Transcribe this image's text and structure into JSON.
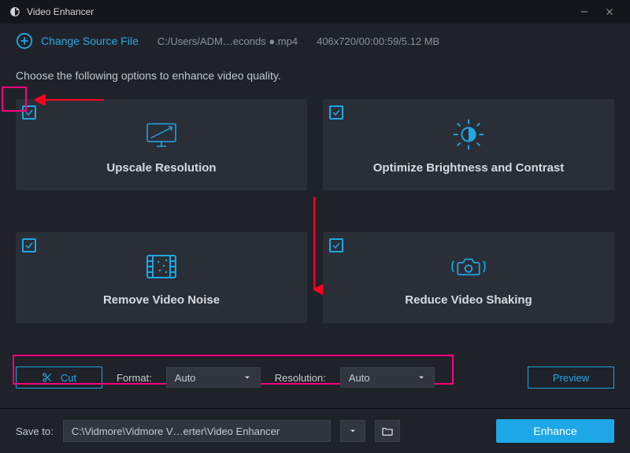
{
  "window": {
    "title": "Video Enhancer"
  },
  "header": {
    "change_source_label": "Change Source File",
    "file_path": "C:/Users/ADM…econds ●.mp4",
    "file_info": "406x720/00:00:59/5.12 MB"
  },
  "instruction": "Choose the following options to enhance video quality.",
  "options": [
    {
      "id": "upscale",
      "label": "Upscale Resolution",
      "checked": true,
      "icon": "monitor-up-icon"
    },
    {
      "id": "brightness",
      "label": "Optimize Brightness and Contrast",
      "checked": true,
      "icon": "brightness-icon"
    },
    {
      "id": "noise",
      "label": "Remove Video Noise",
      "checked": true,
      "icon": "film-noise-icon"
    },
    {
      "id": "shaking",
      "label": "Reduce Video Shaking",
      "checked": true,
      "icon": "camera-shake-icon"
    }
  ],
  "controls": {
    "cut_label": "Cut",
    "format_label": "Format:",
    "format_value": "Auto",
    "resolution_label": "Resolution:",
    "resolution_value": "Auto",
    "preview_label": "Preview"
  },
  "bottom": {
    "save_to_label": "Save to:",
    "save_path": "C:\\Vidmore\\Vidmore V…erter\\Video Enhancer",
    "enhance_label": "Enhance"
  },
  "colors": {
    "accent": "#1ea7e6",
    "highlight": "#ff007b",
    "arrow": "#ff0020"
  }
}
